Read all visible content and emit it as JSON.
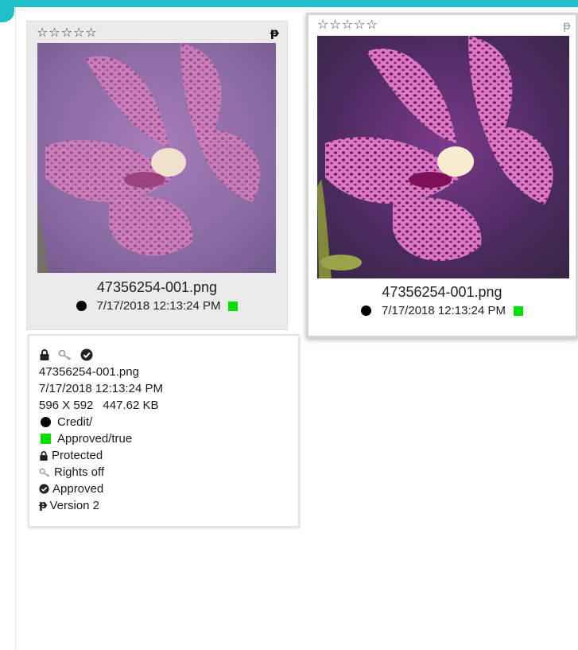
{
  "colors": {
    "accent": "#1ebfc6",
    "status_green": "#00e000",
    "status_black": "#000000"
  },
  "cards": [
    {
      "id": "card-1",
      "rating_stars": [
        "☆",
        "☆",
        "☆",
        "☆",
        "☆"
      ],
      "version_icon_glyph": "ᵽ",
      "filename": "47356254-001.png",
      "datetime": "7/17/2018 12:13:24 PM",
      "selected": false
    },
    {
      "id": "card-2",
      "rating_stars": [
        "☆",
        "☆",
        "☆",
        "☆",
        "☆"
      ],
      "version_icon_glyph": "ᵽ",
      "filename": "47356254-001.png",
      "datetime": "7/17/2018 12:13:24 PM",
      "selected": true
    }
  ],
  "details": {
    "filename": "47356254-001.png",
    "datetime": "7/17/2018 12:13:24 PM",
    "dimensions": "596 X 592",
    "filesize": "447.62 KB",
    "credit": "Credit/",
    "approved_status": "Approved/true",
    "protected": "Protected",
    "rights": "Rights off",
    "approved": "Approved",
    "version": "Version 2"
  }
}
